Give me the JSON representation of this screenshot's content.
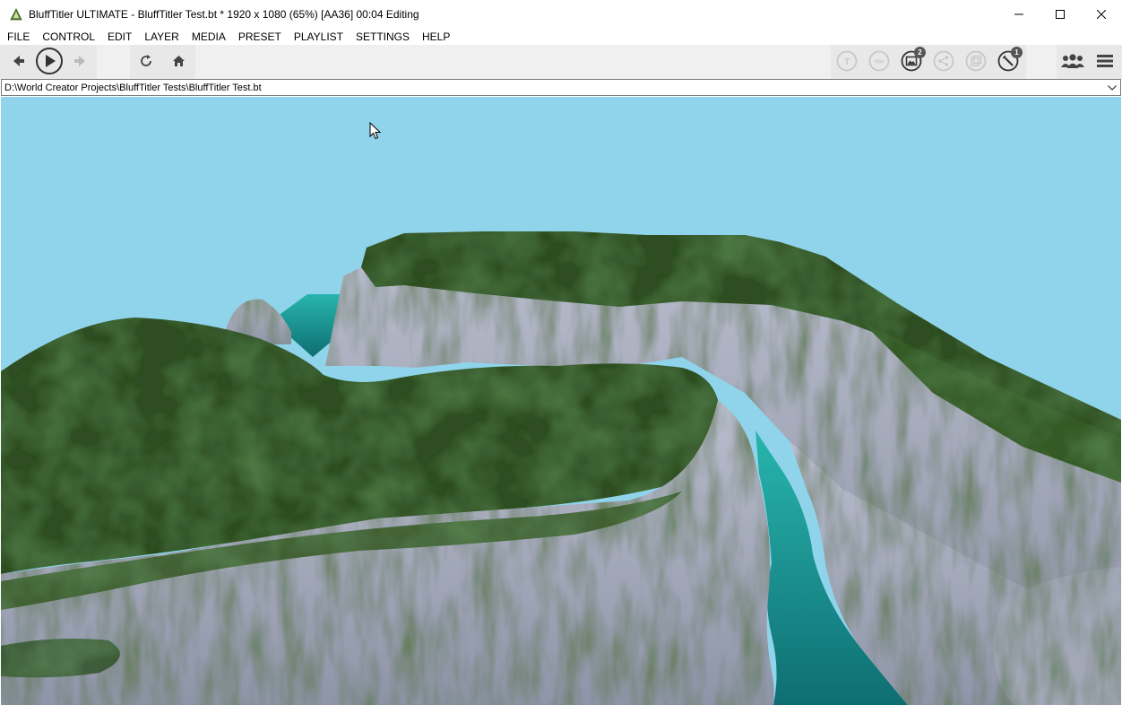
{
  "window": {
    "app_name": "BluffTitler ULTIMATE",
    "title": "BluffTitler ULTIMATE  - BluffTitler Test.bt * 1920 x 1080 (65%) [AA36] 00:04 Editing"
  },
  "menu": [
    "FILE",
    "CONTROL",
    "EDIT",
    "LAYER",
    "MEDIA",
    "PRESET",
    "PLAYLIST",
    "SETTINGS",
    "HELP"
  ],
  "toolbar": {
    "badges": {
      "media": "2",
      "effects": "1"
    }
  },
  "pathbar": {
    "path": "D:\\World Creator Projects\\BluffTitler Tests\\BluffTitler Test.bt"
  },
  "colors": {
    "sky": "#8fd4ea",
    "grass": "#2f4e22",
    "rock": "#a9aebd",
    "water": "#1e9a98",
    "toolbar_bg": "#f0f0f0"
  },
  "icons": {
    "back": "arrow-left-icon",
    "play": "play-circle-icon",
    "forward": "arrow-right-icon",
    "refresh": "refresh-icon",
    "home": "home-icon",
    "text": "text-layer-icon",
    "abc": "abc-layer-icon",
    "media": "picture-icon",
    "share": "share-icon",
    "copy": "copy-layer-icon",
    "effect": "wand-icon",
    "community": "people-icon",
    "menu": "hamburger-icon"
  }
}
